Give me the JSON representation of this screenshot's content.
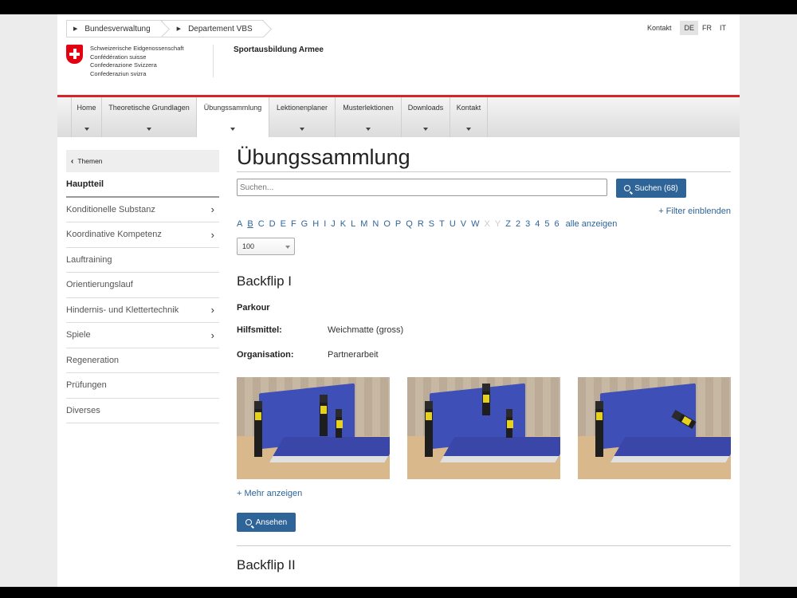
{
  "breadcrumb": [
    "Bundesverwaltung",
    "Departement VBS"
  ],
  "topbar": {
    "contact": "Kontakt",
    "languages": [
      {
        "code": "DE",
        "active": true
      },
      {
        "code": "FR",
        "active": false
      },
      {
        "code": "IT",
        "active": false
      }
    ]
  },
  "confederation": [
    "Schweizerische Eidgenossenschaft",
    "Confédération suisse",
    "Confederazione Svizzera",
    "Confederaziun svizra"
  ],
  "site_title": "Sportausbildung Armee",
  "nav": [
    {
      "label": "Home",
      "active": false
    },
    {
      "label": "Theoretische Grundlagen",
      "active": false
    },
    {
      "label": "Übungssammlung",
      "active": true
    },
    {
      "label": "Lektionenplaner",
      "active": false
    },
    {
      "label": "Musterlektionen",
      "active": false
    },
    {
      "label": "Downloads",
      "active": false
    },
    {
      "label": "Kontakt",
      "active": false
    }
  ],
  "sidebar": {
    "back_label": "Themen",
    "items": [
      {
        "label": "Hauptteil",
        "arrow": false
      },
      {
        "label": "Konditionelle Substanz",
        "arrow": true
      },
      {
        "label": "Koordinative Kompetenz",
        "arrow": true
      },
      {
        "label": "Lauftraining",
        "arrow": false
      },
      {
        "label": "Orientierungslauf",
        "arrow": false
      },
      {
        "label": "Hindernis- und Klettertechnik",
        "arrow": true
      },
      {
        "label": "Spiele",
        "arrow": true
      },
      {
        "label": "Regeneration",
        "arrow": false
      },
      {
        "label": "Prüfungen",
        "arrow": false
      },
      {
        "label": "Diverses",
        "arrow": false
      }
    ]
  },
  "main": {
    "title": "Übungssammlung",
    "search_placeholder": "Suchen...",
    "search_button": "Suchen (68)",
    "filter_link": "+ Filter einblenden",
    "alphabet": [
      {
        "l": "A",
        "on": true
      },
      {
        "l": "B",
        "on": true,
        "current": true
      },
      {
        "l": "C",
        "on": true
      },
      {
        "l": "D",
        "on": true
      },
      {
        "l": "E",
        "on": true
      },
      {
        "l": "F",
        "on": true
      },
      {
        "l": "G",
        "on": true
      },
      {
        "l": "H",
        "on": true
      },
      {
        "l": "I",
        "on": true
      },
      {
        "l": "J",
        "on": true
      },
      {
        "l": "K",
        "on": true
      },
      {
        "l": "L",
        "on": true
      },
      {
        "l": "M",
        "on": true
      },
      {
        "l": "N",
        "on": true
      },
      {
        "l": "O",
        "on": true
      },
      {
        "l": "P",
        "on": true
      },
      {
        "l": "Q",
        "on": true
      },
      {
        "l": "R",
        "on": true
      },
      {
        "l": "S",
        "on": true
      },
      {
        "l": "T",
        "on": true
      },
      {
        "l": "U",
        "on": true
      },
      {
        "l": "V",
        "on": true
      },
      {
        "l": "W",
        "on": true
      },
      {
        "l": "X",
        "on": false
      },
      {
        "l": "Y",
        "on": false
      },
      {
        "l": "Z",
        "on": true
      },
      {
        "l": "2",
        "on": true
      },
      {
        "l": "3",
        "on": true
      },
      {
        "l": "4",
        "on": true
      },
      {
        "l": "5",
        "on": true
      },
      {
        "l": "6",
        "on": true
      }
    ],
    "show_all": "alle anzeigen",
    "page_size": "100",
    "exercise": {
      "title": "Backflip I",
      "category": "Parkour",
      "aid_label": "Hilfsmittel:",
      "aid_value": "Weichmatte (gross)",
      "org_label": "Organisation:",
      "org_value": "Partnerarbeit",
      "more_link": "+ Mehr anzeigen",
      "view_button": "Ansehen"
    },
    "next_title": "Backflip II"
  }
}
